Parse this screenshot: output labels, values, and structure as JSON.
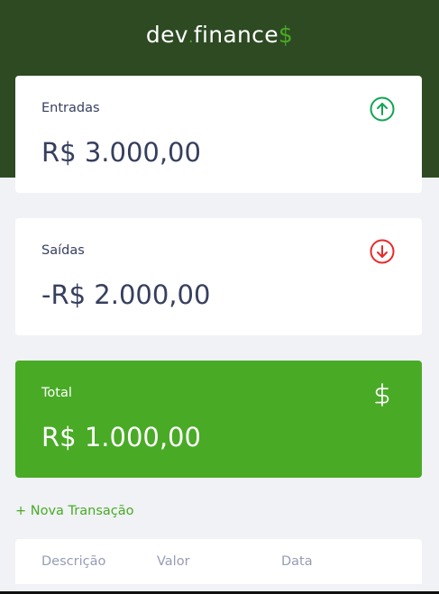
{
  "header": {
    "logo_main": "dev",
    "logo_dot": ".",
    "logo_rest": "finance",
    "logo_symbol": "$"
  },
  "cards": {
    "income": {
      "label": "Entradas",
      "value": "R$ 3.000,00",
      "icon": "arrow-up-circle-icon",
      "color": "#12a454"
    },
    "expense": {
      "label": "Saídas",
      "value": "-R$ 2.000,00",
      "icon": "arrow-down-circle-icon",
      "color": "#e92929"
    },
    "total": {
      "label": "Total",
      "value": "R$ 1.000,00",
      "icon": "dollar-icon",
      "color": "#49aa26"
    }
  },
  "actions": {
    "new_transaction": "+ Nova Transação"
  },
  "table": {
    "headers": [
      "Descrição",
      "Valor",
      "Data"
    ]
  },
  "colors": {
    "header_bg": "#2d4a22",
    "accent": "#49aa26",
    "page_bg": "#f0f2f5",
    "text": "#363f5f",
    "muted": "#969cb3"
  }
}
